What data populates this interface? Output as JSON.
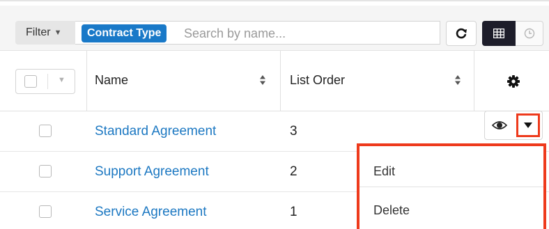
{
  "filter": {
    "label": "Filter",
    "active_filter": "Contract Type",
    "search_placeholder": "Search by name..."
  },
  "table": {
    "columns": [
      "Name",
      "List Order"
    ],
    "rows": [
      {
        "name": "Standard Agreement",
        "list_order": "3"
      },
      {
        "name": "Support Agreement",
        "list_order": "2"
      },
      {
        "name": "Service Agreement",
        "list_order": "1"
      }
    ]
  },
  "row_menu": {
    "items": [
      "Edit",
      "Delete"
    ]
  },
  "colors": {
    "link": "#1c78c2",
    "pill": "#1979c8",
    "highlight": "#ee3a1c",
    "active_view": "#1d1d2a"
  },
  "icons": [
    "chevron-down-icon",
    "refresh-icon",
    "grid-view-icon",
    "clock-icon",
    "sort-icon",
    "gear-icon",
    "eye-icon",
    "caret-down-icon"
  ]
}
